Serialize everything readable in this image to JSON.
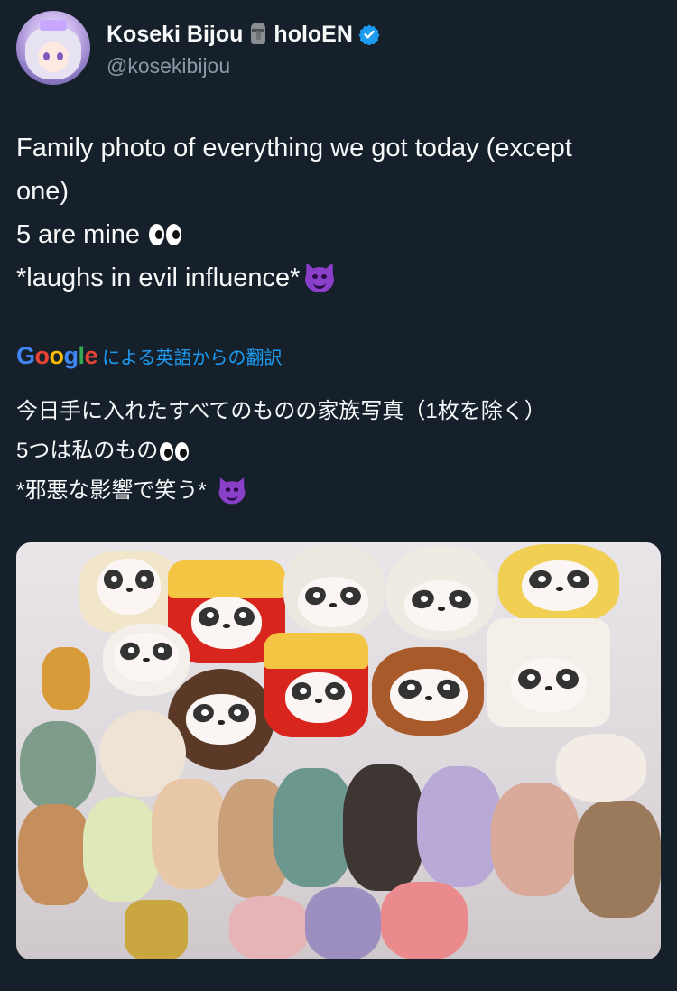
{
  "user": {
    "display_name": "Koseki Bijou",
    "name_suffix": "holoEN",
    "handle": "@kosekibijou",
    "name_emoji": "moai-icon",
    "verified_icon": "verified-icon",
    "verified_color": "#1d9bf0"
  },
  "tweet": {
    "lines": [
      "Family photo of everything we got today (except",
      "one)",
      "5 are mine",
      "*laughs in evil influence*"
    ],
    "line3_emoji": "eyes-icon",
    "line4_emoji": "smiling-devil-icon"
  },
  "translation": {
    "provider": "Google",
    "label": "による英語からの翻訳",
    "lines": [
      "今日手に入れたすべてのものの家族写真（1枚を除く）",
      "5つは私のもの",
      "*邪悪な影響で笑う*"
    ]
  },
  "media": {
    "subject": "photo-of-plush-toys"
  },
  "colors": {
    "background": "#15202b",
    "text": "#f7f9f9",
    "secondary_text": "#8b98a5",
    "accent": "#1d9bf0"
  }
}
